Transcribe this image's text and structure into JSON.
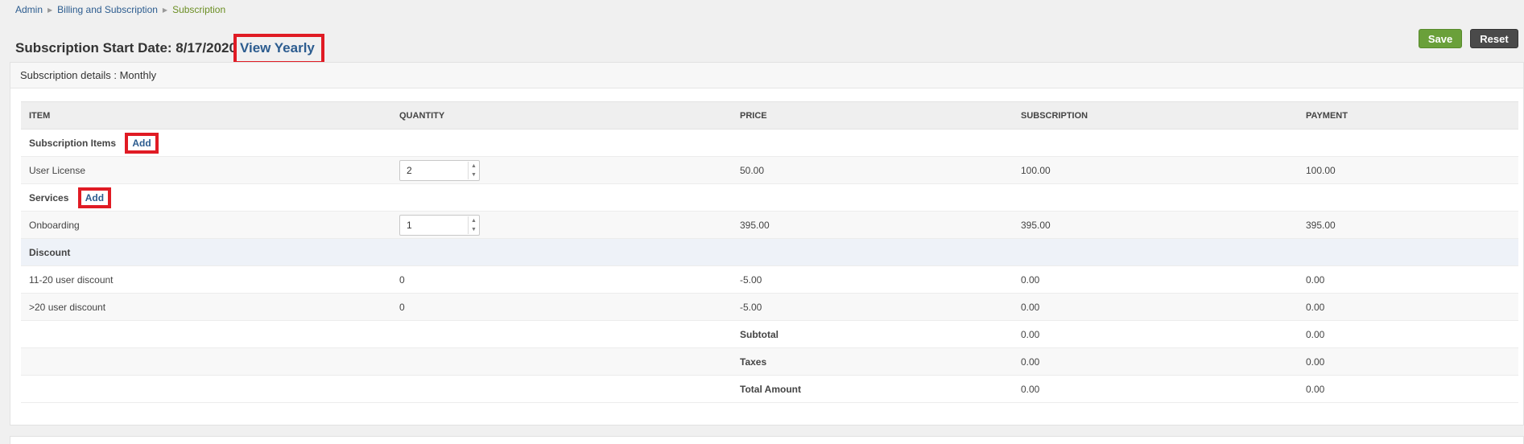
{
  "breadcrumb": {
    "admin": "Admin",
    "billing": "Billing and Subscription",
    "current": "Subscription"
  },
  "header": {
    "title": "Subscription Start Date: 8/17/2020",
    "view_link": "View Yearly"
  },
  "actions": {
    "save": "Save",
    "reset": "Reset"
  },
  "panel": {
    "title": "Subscription details : Monthly"
  },
  "table": {
    "columns": [
      "ITEM",
      "QUANTITY",
      "PRICE",
      "SUBSCRIPTION",
      "PAYMENT"
    ],
    "subscription_group": {
      "label": "Subscription Items",
      "add": "Add"
    },
    "user_license": {
      "item": "User License",
      "quantity": "2",
      "price": "50.00",
      "subscription": "100.00",
      "payment": "100.00"
    },
    "services_group": {
      "label": "Services",
      "add": "Add"
    },
    "onboarding": {
      "item": "Onboarding",
      "quantity": "1",
      "price": "395.00",
      "subscription": "395.00",
      "payment": "395.00"
    },
    "discount_group": {
      "label": "Discount"
    },
    "discount_1": {
      "item": "11-20 user discount",
      "quantity": "0",
      "price": "-5.00",
      "subscription": "0.00",
      "payment": "0.00"
    },
    "discount_2": {
      "item": ">20 user discount",
      "quantity": "0",
      "price": "-5.00",
      "subscription": "0.00",
      "payment": "0.00"
    },
    "subtotal": {
      "label": "Subtotal",
      "subscription": "0.00",
      "payment": "0.00"
    },
    "taxes": {
      "label": "Taxes",
      "subscription": "0.00",
      "payment": "0.00"
    },
    "total": {
      "label": "Total Amount",
      "subscription": "0.00",
      "payment": "0.00"
    }
  }
}
